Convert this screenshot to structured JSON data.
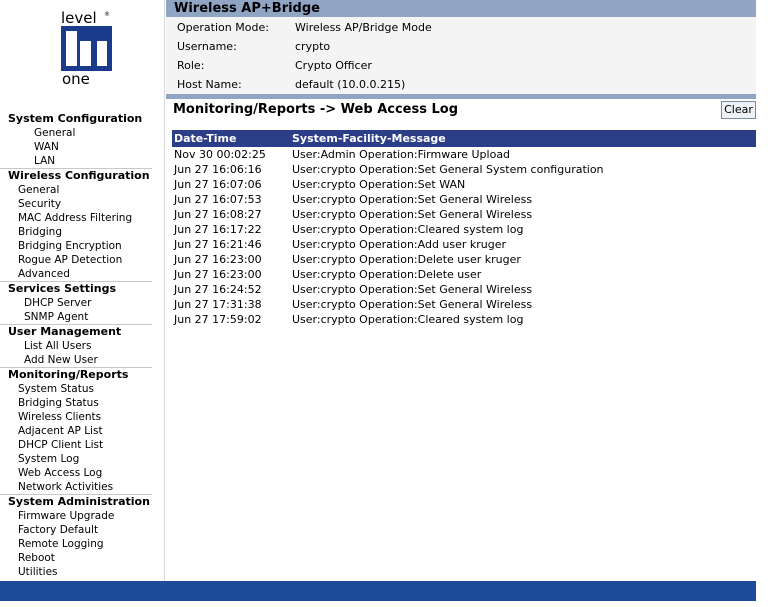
{
  "logo": {
    "line1": "level",
    "line2": "one",
    "trademark": "®"
  },
  "header": {
    "title": "Wireless AP+Bridge"
  },
  "info": [
    {
      "label": "Operation Mode:",
      "value": "Wireless AP/Bridge Mode"
    },
    {
      "label": "Username:",
      "value": "crypto"
    },
    {
      "label": "Role:",
      "value": "Crypto Officer"
    },
    {
      "label": "Host Name:",
      "value": "default (10.0.0.215)"
    }
  ],
  "page": {
    "heading": "Monitoring/Reports -> Web Access Log",
    "clear_label": "Clear"
  },
  "table": {
    "columns": [
      "Date-Time",
      "System-Facility-Message"
    ],
    "rows": [
      {
        "dt": "Nov 30 00:02:25",
        "msg": "User:Admin Operation:Firmware Upload"
      },
      {
        "dt": "Jun 27 16:06:16",
        "msg": "User:crypto Operation:Set General System configuration"
      },
      {
        "dt": "Jun 27 16:07:06",
        "msg": "User:crypto Operation:Set WAN"
      },
      {
        "dt": "Jun 27 16:07:53",
        "msg": "User:crypto Operation:Set General Wireless"
      },
      {
        "dt": "Jun 27 16:08:27",
        "msg": "User:crypto Operation:Set General Wireless"
      },
      {
        "dt": "Jun 27 16:17:22",
        "msg": "User:crypto Operation:Cleared system log"
      },
      {
        "dt": "Jun 27 16:21:46",
        "msg": "User:crypto Operation:Add user kruger"
      },
      {
        "dt": "Jun 27 16:23:00",
        "msg": "User:crypto Operation:Delete user kruger"
      },
      {
        "dt": "Jun 27 16:23:00",
        "msg": "User:crypto Operation:Delete user"
      },
      {
        "dt": "Jun 27 16:24:52",
        "msg": "User:crypto Operation:Set General Wireless"
      },
      {
        "dt": "Jun 27 17:31:38",
        "msg": "User:crypto Operation:Set General Wireless"
      },
      {
        "dt": "Jun 27 17:59:02",
        "msg": "User:crypto Operation:Cleared system log"
      }
    ]
  },
  "nav": {
    "system_configuration": {
      "title": "System Configuration",
      "items": [
        "General",
        "WAN",
        "LAN"
      ]
    },
    "wireless_configuration": {
      "title": "Wireless Configuration",
      "items": [
        "General",
        "Security",
        "MAC Address Filtering",
        "Bridging",
        "Bridging Encryption",
        "Rogue AP Detection",
        "Advanced"
      ]
    },
    "services_settings": {
      "title": "Services Settings",
      "items": [
        "DHCP Server",
        "SNMP Agent"
      ]
    },
    "user_management": {
      "title": "User Management",
      "items": [
        "List All Users",
        "Add New User"
      ]
    },
    "monitoring_reports": {
      "title": "Monitoring/Reports",
      "items": [
        "System Status",
        "Bridging Status",
        "Wireless Clients",
        "Adjacent AP List",
        "DHCP Client List",
        "System Log",
        "Web Access Log",
        "Network Activities"
      ]
    },
    "system_administration": {
      "title": "System Administration",
      "items": [
        "Firmware Upgrade",
        "Factory Default",
        "Remote Logging",
        "Reboot",
        "Utilities"
      ]
    }
  },
  "colors": {
    "title_bar": "#90a4c4",
    "table_header": "#2c3e88",
    "footer_bar": "#1e4a9a",
    "logo_blue": "#1a3a8c"
  }
}
